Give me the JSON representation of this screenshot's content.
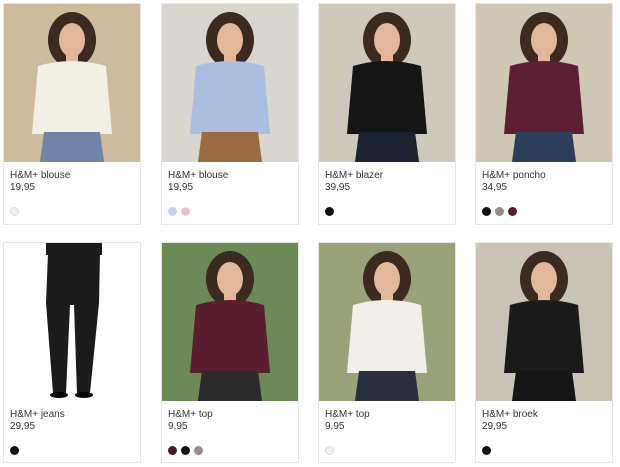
{
  "products": [
    {
      "name": "H&M+ blouse",
      "price": "19,95",
      "image": "model-white-blouse-photo",
      "swatches": [
        {
          "color": "#eeeeee",
          "label": "white"
        }
      ],
      "palette": {
        "bg": "#cdbb9e",
        "top": "#f2efe6",
        "bottom": "#6f86a8",
        "hair": "#3a2a20"
      }
    },
    {
      "name": "H&M+ blouse",
      "price": "19,95",
      "image": "model-light-blue-blouse-photo",
      "swatches": [
        {
          "color": "#c4d2ee",
          "label": "light blue"
        },
        {
          "color": "#f0bfcf",
          "label": "pink"
        }
      ],
      "palette": {
        "bg": "#d9d5cf",
        "top": "#aabfe0",
        "bottom": "#9a6a40",
        "hair": "#3a2a20"
      }
    },
    {
      "name": "H&M+ blazer",
      "price": "39,95",
      "image": "model-black-blazer-photo",
      "swatches": [
        {
          "color": "#111111",
          "label": "black"
        }
      ],
      "palette": {
        "bg": "#cfc9bd",
        "top": "#151515",
        "bottom": "#1d2230",
        "hair": "#3a2a20"
      }
    },
    {
      "name": "H&M+ poncho",
      "price": "34,95",
      "image": "model-burgundy-poncho-photo",
      "swatches": [
        {
          "color": "#111111",
          "label": "black"
        },
        {
          "color": "#9c8a82",
          "label": "grey brown"
        },
        {
          "color": "#5a1b2c",
          "label": "burgundy"
        }
      ],
      "palette": {
        "bg": "#cfc6b4",
        "top": "#5d1f33",
        "bottom": "#2d3d5c",
        "hair": "#3a2a20"
      }
    },
    {
      "name": "H&M+ jeans",
      "price": "29,95",
      "image": "black-jeans-photo",
      "swatches": [
        {
          "color": "#111111",
          "label": "black"
        }
      ],
      "palette": {
        "bg": "#ffffff",
        "top": "#1b1b1b",
        "bottom": "#1b1b1b",
        "hair": "#ffffff"
      }
    },
    {
      "name": "H&M+ top",
      "price": "9,95",
      "image": "model-burgundy-top-photo",
      "swatches": [
        {
          "color": "#4d1728",
          "label": "burgundy"
        },
        {
          "color": "#111111",
          "label": "black"
        },
        {
          "color": "#9c8a8a",
          "label": "grey"
        }
      ],
      "palette": {
        "bg": "#6b8a58",
        "top": "#5b1d30",
        "bottom": "#2a2a2a",
        "hair": "#3a2a20"
      }
    },
    {
      "name": "H&M+ top",
      "price": "9,95",
      "image": "model-dotted-top-photo",
      "swatches": [
        {
          "color": "#f2f0ee",
          "label": "off white"
        }
      ],
      "palette": {
        "bg": "#9aa27a",
        "top": "#f2efea",
        "bottom": "#2a2f3e",
        "hair": "#3a2a20"
      }
    },
    {
      "name": "H&M+ broek",
      "price": "29,95",
      "image": "model-black-trousers-photo",
      "swatches": [
        {
          "color": "#111111",
          "label": "black"
        }
      ],
      "palette": {
        "bg": "#c9c2b6",
        "top": "#1a1a1a",
        "bottom": "#151515",
        "hair": "#3a2a20"
      }
    }
  ]
}
